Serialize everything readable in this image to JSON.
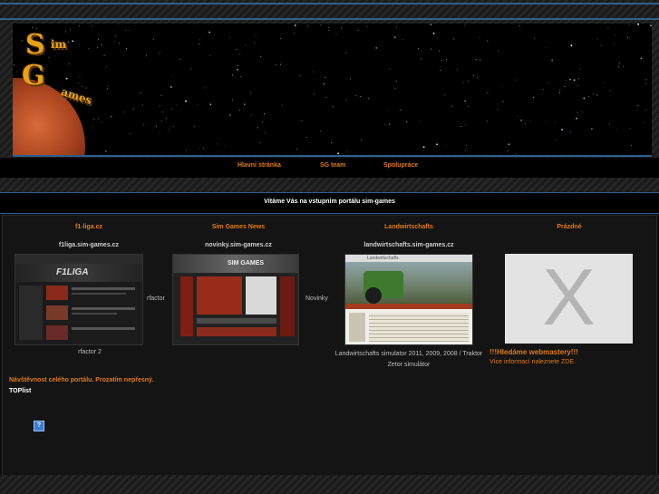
{
  "logo": {
    "letters": [
      "S",
      "im",
      "G",
      "ames"
    ]
  },
  "nav": [
    {
      "label": "Hlavní stránka"
    },
    {
      "label": "SG team"
    },
    {
      "label": "Spolupráce"
    }
  ],
  "welcome": "Vítáme Vás na vstupním portálu sim-games",
  "columns": [
    {
      "title": "f1-liga.cz",
      "domain": "f1liga.sim-games.cz",
      "side_label": "rfactor",
      "caption": "rfactor 2"
    },
    {
      "title": "Sim Games News",
      "domain": "novinky.sim-games.cz",
      "side_label": "Novinky",
      "caption": ""
    },
    {
      "title": "Landwirtschafts",
      "domain": "landwirtschafts.sim-games.cz",
      "side_label": "",
      "caption": "Landwirtschafts simulator 2011, 2009, 2008 / Traktor Zetor simulátor"
    },
    {
      "title": "Prázdné",
      "domain": "",
      "side_label": "",
      "caption": ""
    }
  ],
  "thumbs": {
    "f1liga_header": "F1LIGA",
    "news_header": "SIM GAMES",
    "farm_header": "Landwirtschafts",
    "empty_mark": "X"
  },
  "visits": "Návštěvnost celého portálu. Prozatím nepřesný.",
  "toplist": "TOPlist",
  "toplist_icon": "?",
  "wanted": "!!!Hledáme webmastery!!!",
  "more_info": "Více informací naleznete ZDE.",
  "colors": {
    "accent": "#e07b17",
    "rule": "#2e5f8e",
    "logo": "#e8a317"
  }
}
